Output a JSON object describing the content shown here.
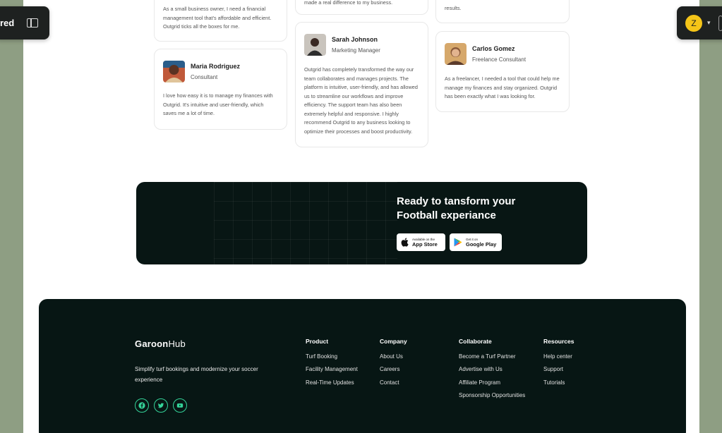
{
  "overlay_left": {
    "label": "red"
  },
  "overlay_right": {
    "avatar_letter": "Z"
  },
  "testimonials": {
    "card1": {
      "text": "As a small business owner, I need a financial management tool that's affordable and efficient. Outgrid ticks all the boxes for me."
    },
    "card2": {
      "text": "made a real difference to my business."
    },
    "card3": {
      "text": "results."
    },
    "card4": {
      "name": "Maria Rodriguez",
      "role": "Consultant",
      "text": "I love how easy it is to manage my finances with Outgrid. It's intuitive and user-friendly, which saves me a lot of time."
    },
    "card5": {
      "name": "Sarah Johnson",
      "role": "Marketing Manager",
      "text": "Outgrid has completely transformed the way our team collaborates and manages projects. The platform is intuitive, user-friendly, and has allowed us to streamline our workflows and improve efficiency. The support team has also been extremely helpful and responsive. I highly recommend Outgrid to any business looking to optimize their processes and boost productivity."
    },
    "card6": {
      "name": "Carlos Gomez",
      "role": "Freelance Consultant",
      "text": "As a freelancer, I needed a tool that could help me manage my finances and stay organized. Outgrid has been exactly what I was looking for."
    }
  },
  "cta": {
    "title": "Ready to tansform your Football experiance",
    "app_store": {
      "small": "Available on the",
      "big": "App Store"
    },
    "google_play": {
      "small": "Get it on",
      "big": "Google Play"
    }
  },
  "footer": {
    "logo_g": "G",
    "logo_aroon": "aroon",
    "logo_hub": "Hub",
    "tagline": "Simplify turf bookings and modernize your soccer experience",
    "socials": [
      "facebook-icon",
      "twitter-icon",
      "youtube-icon"
    ],
    "accent": "#34d399",
    "columns": [
      {
        "heading": "Product",
        "links": [
          "Turf Booking",
          "Facility Management",
          "Real-Time Updates"
        ]
      },
      {
        "heading": "Company",
        "links": [
          "About Us",
          "Careers",
          "Contact"
        ]
      },
      {
        "heading": "Collaborate",
        "links": [
          "Become a Turf Partner",
          "Advertise with Us",
          "Affiliate Program",
          "Sponsorship Opportunities"
        ]
      },
      {
        "heading": "Resources",
        "links": [
          "Help center",
          "Support",
          "Tutorials"
        ]
      }
    ]
  }
}
